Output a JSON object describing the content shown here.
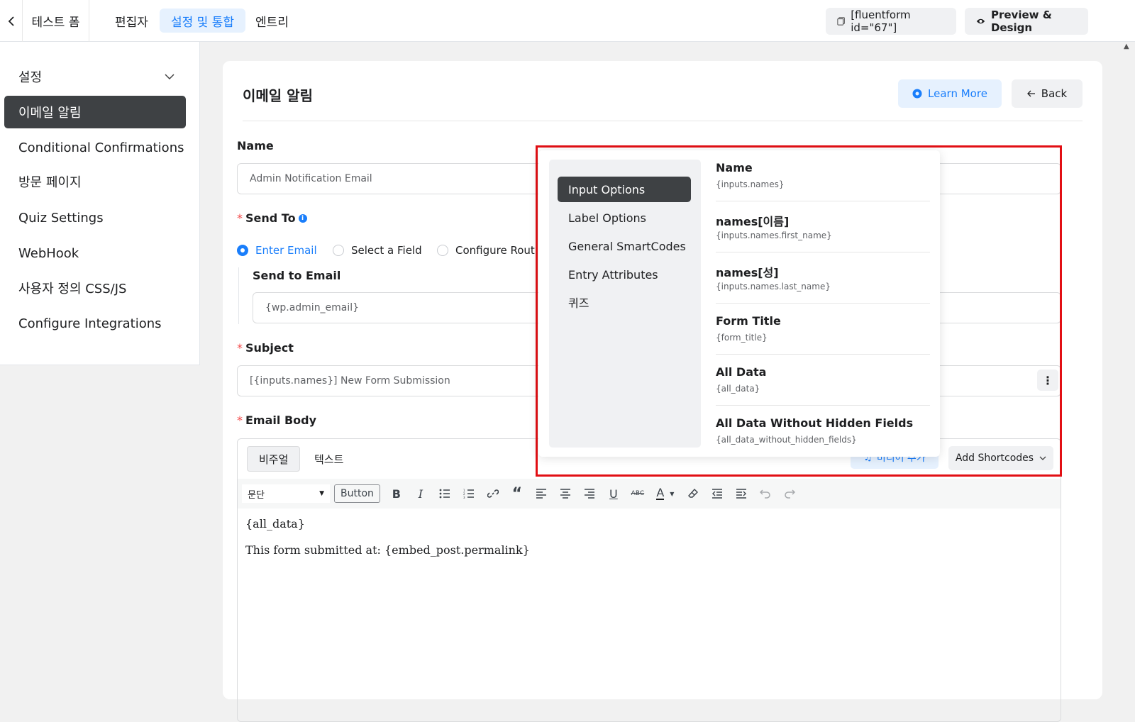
{
  "header": {
    "form_title": "테스트 폼",
    "tabs": [
      {
        "label": "편집자"
      },
      {
        "label": "설정 및 통합"
      },
      {
        "label": "엔트리"
      }
    ],
    "shortcode_label": "[fluentform id=\"67\"]",
    "preview_label": "Preview & Design"
  },
  "sidebar": {
    "section_title": "설정",
    "items": [
      {
        "label": "이메일 알림"
      },
      {
        "label": "Conditional Confirmations"
      },
      {
        "label": "방문 페이지"
      },
      {
        "label": "Quiz Settings"
      },
      {
        "label": "WebHook"
      },
      {
        "label": "사용자 정의 CSS/JS"
      },
      {
        "label": "Configure Integrations"
      }
    ]
  },
  "main": {
    "title": "이메일 알림",
    "learn_more": "Learn More",
    "back": "Back",
    "name_label": "Name",
    "name_value": "Admin Notification Email",
    "send_to_label": "Send To",
    "send_to_options": [
      {
        "label": "Enter Email"
      },
      {
        "label": "Select a Field"
      },
      {
        "label": "Configure Routing"
      }
    ],
    "send_to_email_label": "Send to Email",
    "send_to_email_value": "{wp.admin_email}",
    "subject_label": "Subject",
    "subject_value": "[{inputs.names}] New Form Submission",
    "email_body_label": "Email Body",
    "editor": {
      "tab_visual": "비주얼",
      "tab_text": "텍스트",
      "add_media": "미디어 추가",
      "add_shortcodes": "Add Shortcodes",
      "paragraph": "문단",
      "button_label": "Button",
      "content_lines": [
        "{all_data}",
        "This form submitted at: {embed_post.permalink}"
      ]
    }
  },
  "shortcode_popover": {
    "categories": [
      {
        "label": "Input Options"
      },
      {
        "label": "Label Options"
      },
      {
        "label": "General SmartCodes"
      },
      {
        "label": "Entry Attributes"
      },
      {
        "label": "퀴즈"
      }
    ],
    "items": [
      {
        "title": "Name",
        "code": "{inputs.names}"
      },
      {
        "title": "names[이름]",
        "code": "{inputs.names.first_name}"
      },
      {
        "title": "names[성]",
        "code": "{inputs.names.last_name}"
      },
      {
        "title": "Form Title",
        "code": "{form_title}"
      },
      {
        "title": "All Data",
        "code": "{all_data}"
      },
      {
        "title": "All Data Without Hidden Fields",
        "code": "{all_data_without_hidden_fields}"
      }
    ]
  },
  "colors": {
    "accent": "#1a7efb",
    "dark": "#3e4144",
    "required": "#f34a4a",
    "highlight": "#e20f14"
  }
}
